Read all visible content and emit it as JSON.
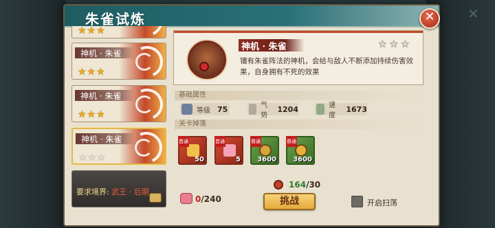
{
  "dialog": {
    "title": "朱雀试炼"
  },
  "stages": [
    {
      "name": "",
      "stars_filled": 3,
      "stars_empty": 0
    },
    {
      "name": "神机 · 朱雀",
      "stars_filled": 3,
      "stars_empty": 0
    },
    {
      "name": "神机 · 朱雀",
      "stars_filled": 3,
      "stars_empty": 0
    },
    {
      "name": "神机 · 朱雀",
      "stars_filled": 0,
      "stars_empty": 3,
      "selected": true
    },
    {
      "locked": true,
      "requirement_label": "要求境界:",
      "requirement_value": "武王 · 后期"
    }
  ],
  "stage_stars": {
    "s0": "★★★",
    "s1": "★★★",
    "s2": "★★★",
    "s3": "☆☆☆"
  },
  "boss": {
    "name": "神机 · 朱雀",
    "stars": "☆☆☆",
    "description": "镶有朱雀阵法的神机，会给与敌人不断添加持续伤害效果，自身拥有不死的效果"
  },
  "sections": {
    "attributes": "基础属性",
    "drops": "关卡掉落"
  },
  "attributes": [
    {
      "label": "等级",
      "value": "75",
      "icon": "level-icon"
    },
    {
      "label": "气势",
      "value": "1204",
      "icon": "momentum-icon"
    },
    {
      "label": "速度",
      "value": "1673",
      "icon": "speed-icon"
    }
  ],
  "drops": [
    {
      "tag": "首通",
      "qty": "50",
      "icon": "gold-ingot-icon"
    },
    {
      "tag": "首通",
      "qty": "5",
      "icon": "ticket-icon"
    },
    {
      "tag": "普通",
      "qty": "3600",
      "icon": "coin-icon"
    },
    {
      "tag": "普通",
      "qty": "3600",
      "icon": "rare-coin-icon"
    }
  ],
  "cost": {
    "current": "164",
    "max": "/30"
  },
  "tickets": {
    "current": "0",
    "max": "/240"
  },
  "actions": {
    "challenge": "挑战",
    "sweep": "开启扫荡"
  },
  "colors": {
    "title_bar": "#2a7078",
    "accent_red": "#c04a2c",
    "gold": "#e5a93b",
    "panel": "#e9e1cf"
  }
}
